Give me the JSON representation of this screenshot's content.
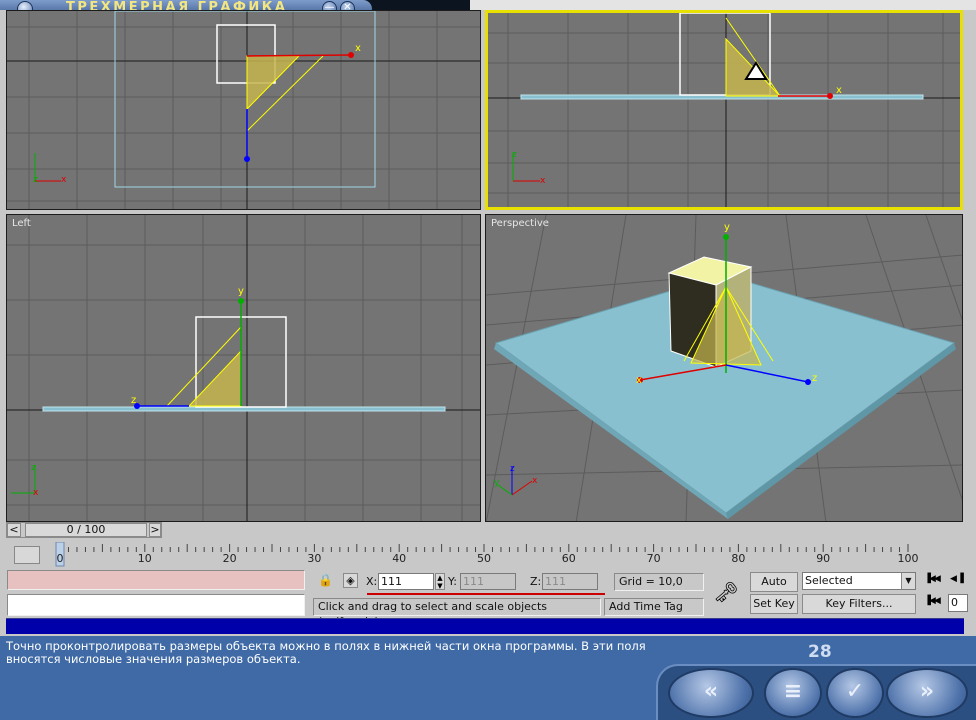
{
  "app": {
    "title": "ТРЕХМЕРНАЯ ГРАФИКА",
    "minimize_glyph": "—",
    "close_glyph": "✕"
  },
  "viewports": {
    "top_left": {
      "label": ""
    },
    "top_right": {
      "label": ""
    },
    "left": {
      "label": "Left"
    },
    "perspective": {
      "label": "Perspective"
    },
    "axis_labels": {
      "x": "x",
      "y": "y",
      "z": "z"
    }
  },
  "timeline": {
    "slider_text": "0 / 100",
    "prev_glyph": "<",
    "next_glyph": ">",
    "ticks": [
      "0",
      "10",
      "20",
      "30",
      "40",
      "50",
      "60",
      "70",
      "80",
      "90",
      "100"
    ],
    "current_frame": 0
  },
  "status": {
    "x_label": "X:",
    "x_value": "111",
    "y_label": "Y:",
    "y_value": "111",
    "z_label": "Z:",
    "z_value": "111",
    "grid": "Grid = 10,0",
    "prompt": "Click and drag to select and scale objects (uniformly)",
    "add_time_tag": "Add Time Tag",
    "auto_key": "Auto Key",
    "set_key": "Set Key",
    "selected": "Selected",
    "key_filters": "Key Filters...",
    "frame_field": "0"
  },
  "lesson": {
    "text_line1": "Точно проконтролировать размеры объекта можно в полях в нижней части окна программы. В эти поля",
    "text_line2": "вносятся числовые значения размеров объекта.",
    "page_number": "28",
    "nav": {
      "first": "«",
      "prev": "‹",
      "menu": "≡",
      "ok": "✓",
      "next": "»"
    }
  },
  "colors": {
    "selection_yellow": "#ffff00",
    "ground_plane": "#89c0cf",
    "grid_line": "#5c5c5c",
    "lesson_bg": "#3f6aa5",
    "key_field": "#e7c0c0"
  }
}
